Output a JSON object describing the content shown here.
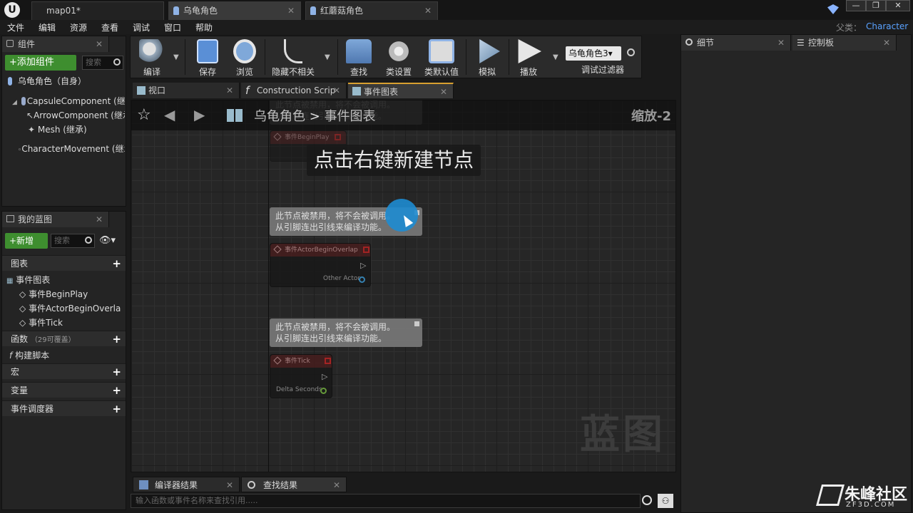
{
  "title_bar": {
    "tabs": [
      {
        "label": "map01*"
      },
      {
        "label": "乌龟角色"
      },
      {
        "label": "红蘑菇角色"
      }
    ]
  },
  "menu": {
    "items": [
      "文件",
      "编辑",
      "资源",
      "查看",
      "调试",
      "窗口",
      "帮助"
    ],
    "parent_label": "父类：",
    "parent_value": "Character"
  },
  "components_panel": {
    "tab": "组件",
    "add_button": "+添加组件",
    "search_placeholder": "搜索",
    "root": "乌龟角色（自身）",
    "items": [
      "CapsuleComponent (继承",
      "ArrowComponent (继承",
      "Mesh (继承)",
      "CharacterMovement (继承"
    ]
  },
  "blueprint_panel": {
    "tab": "我的蓝图",
    "new_button": "+新增",
    "search_placeholder": "搜索",
    "graphs_label": "图表",
    "event_graph": "事件图表",
    "events": [
      "事件BeginPlay",
      "事件ActorBeginOverla",
      "事件Tick"
    ],
    "functions_label": "函数",
    "functions_count": "（29可覆盖）",
    "construct": "构建脚本",
    "macros": "宏",
    "variables": "变量",
    "dispatchers": "事件调度器"
  },
  "toolbar": {
    "compile": "编译",
    "save": "保存",
    "browse": "浏览",
    "hide_unrelated": "隐藏不相关",
    "find": "查找",
    "class_settings": "类设置",
    "class_defaults": "类默认值",
    "simulate": "模拟",
    "play": "播放",
    "debug_dropdown": "乌龟角色3",
    "debug_filter": "调试过滤器"
  },
  "editor_tabs": [
    "视口",
    "Construction Scrip",
    "事件图表"
  ],
  "graph": {
    "breadcrumb_root": "乌龟角色",
    "breadcrumb_sep": ">",
    "breadcrumb_current": "事件图表",
    "zoom": "缩放-2",
    "hint": "点击右键新建节点",
    "watermark": "蓝图",
    "comment_line1": "此节点被禁用，将不会被调用。",
    "comment_line2": "从引脚连出引线来编译功能。",
    "nodes": [
      {
        "title": "事件BeginPlay"
      },
      {
        "title": "事件ActorBeginOverlap",
        "pin": "Other Actor"
      },
      {
        "title": "事件Tick",
        "pin": "Delta Seconds"
      }
    ]
  },
  "details_panel": {
    "tab": "细节"
  },
  "palette_panel": {
    "tab": "控制板"
  },
  "bottom": {
    "compiler_results": "编译器结果",
    "find_results": "查找结果",
    "search_placeholder": "输入函数或事件名称来查找引用....."
  },
  "branding": {
    "name": "朱峰社区",
    "url": "ZF3D.COM"
  }
}
